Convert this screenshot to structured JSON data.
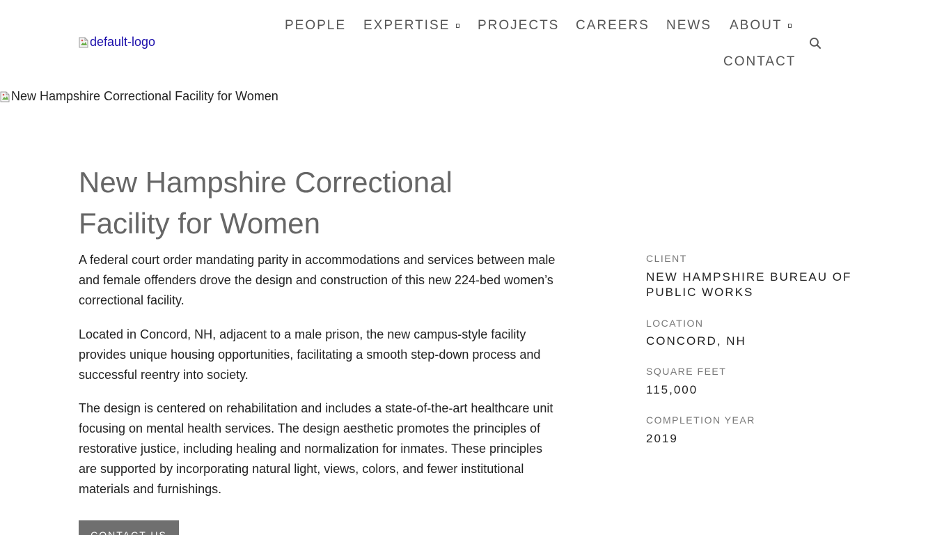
{
  "header": {
    "logo_alt": "default-logo",
    "nav": {
      "people": "PEOPLE",
      "expertise": "EXPERTISE",
      "projects": "PROJECTS",
      "careers": "CAREERS",
      "news": "NEWS",
      "about": "ABOUT",
      "contact": "CONTACT"
    },
    "icons": {
      "search": "search-icon",
      "dropdown": "chevron-down-icon",
      "broken_image": "broken-image-icon"
    }
  },
  "hero": {
    "image_alt": "New Hampshire Correctional Facility for Women"
  },
  "project": {
    "title": "New Hampshire Correctional Facility for Women",
    "paragraphs": [
      "A federal court order mandating parity in accommodations and services between male and female offenders drove the design and construction of this new 224-bed women’s correctional facility.",
      "Located in Concord, NH, adjacent to a male prison, the new campus-style facility provides unique housing opportunities, facilitating a smooth step-down process and successful reentry into society.",
      "The design is centered on rehabilitation and includes a state-of-the-art healthcare unit focusing on mental health services. The design aesthetic promotes the principles of restorative justice, including healing and normalization for inmates. These principles are supported by incorporating natural light, views, colors, and fewer institutional materials and furnishings."
    ],
    "cta_label": "CONTACT US"
  },
  "details": {
    "client_label": "CLIENT",
    "client_value": "NEW HAMPSHIRE BUREAU OF PUBLIC WORKS",
    "location_label": "LOCATION",
    "location_value": "CONCORD, NH",
    "sqft_label": "SQUARE FEET",
    "sqft_value": "115,000",
    "year_label": "COMPLETION YEAR",
    "year_value": "2019"
  },
  "colors": {
    "nav_text": "#555555",
    "title_text": "#666666",
    "body_text": "#222222",
    "meta_label": "#777777",
    "button_bg": "#6f6f6f",
    "link": "#1a0dab"
  }
}
